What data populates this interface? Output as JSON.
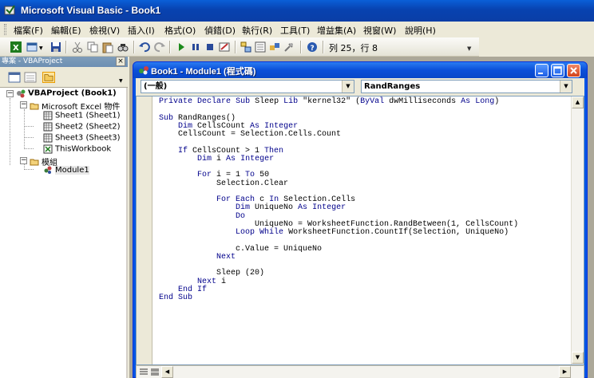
{
  "window": {
    "title": "Microsoft Visual Basic - Book1"
  },
  "menus": [
    {
      "label": "檔案(F)"
    },
    {
      "label": "編輯(E)"
    },
    {
      "label": "檢視(V)"
    },
    {
      "label": "插入(I)"
    },
    {
      "label": "格式(O)"
    },
    {
      "label": "偵錯(D)"
    },
    {
      "label": "執行(R)"
    },
    {
      "label": "工具(T)"
    },
    {
      "label": "增益集(A)"
    },
    {
      "label": "視窗(W)"
    },
    {
      "label": "說明(H)"
    }
  ],
  "toolbar": {
    "position_text": "列 25，行 8"
  },
  "project": {
    "pane_title": "專案 - VBAProject",
    "close_glyph": "×",
    "tree": {
      "root": "VBAProject (Book1)",
      "excel_objects_folder": "Microsoft Excel 物件",
      "sheets": [
        "Sheet1 (Sheet1)",
        "Sheet2 (Sheet2)",
        "Sheet3 (Sheet3)"
      ],
      "workbook": "ThisWorkbook",
      "modules_folder": "模組",
      "module": "Module1"
    }
  },
  "code_window": {
    "title": "Book1 - Module1 (程式碼)",
    "object_combo": "(一般)",
    "procedure_combo": "RandRanges",
    "code_lines": [
      "Private Declare Sub Sleep Lib \"kernel32\" (ByVal dwMilliseconds As Long)",
      "",
      "Sub RandRanges()",
      "    Dim CellsCount As Integer",
      "    CellsCount = Selection.Cells.Count",
      "",
      "    If CellsCount > 1 Then",
      "        Dim i As Integer",
      "",
      "        For i = 1 To 50",
      "            Selection.Clear",
      "",
      "            For Each c In Selection.Cells",
      "                Dim UniqueNo As Integer",
      "                Do",
      "                    UniqueNo = WorksheetFunction.RandBetween(1, CellsCount)",
      "                Loop While WorksheetFunction.CountIf(Selection, UniqueNo)",
      "",
      "                c.Value = UniqueNo",
      "            Next",
      "",
      "            Sleep (20)",
      "        Next i",
      "    End If",
      "End Sub"
    ]
  },
  "colors": {
    "keyword": "#00008b",
    "titlebar": "#0842b0"
  }
}
